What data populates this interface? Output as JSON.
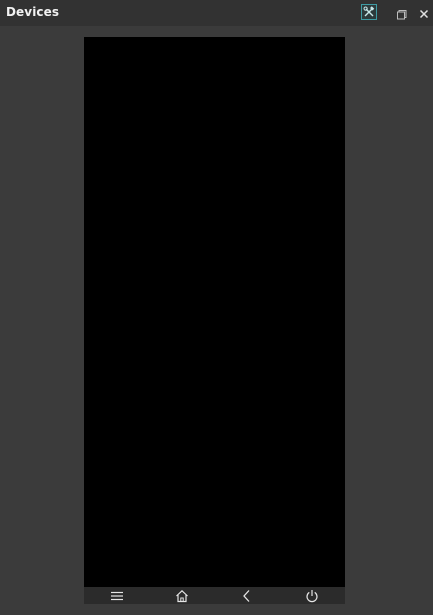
{
  "window": {
    "title": "Devices"
  },
  "toolbar": {
    "tools_icon": "hammer-wrench-icon",
    "restore_icon": "restore-window-icon",
    "close_icon": "close-icon"
  },
  "device": {
    "screen_state": "off",
    "nav_buttons": [
      {
        "name": "menu",
        "icon": "menu-icon"
      },
      {
        "name": "home",
        "icon": "home-icon"
      },
      {
        "name": "back",
        "icon": "back-icon"
      },
      {
        "name": "power",
        "icon": "power-icon"
      }
    ]
  },
  "colors": {
    "panel_bg": "#3b3b3b",
    "titlebar_bg": "#323232",
    "accent": "#3e9ba3",
    "screen": "#000000"
  }
}
